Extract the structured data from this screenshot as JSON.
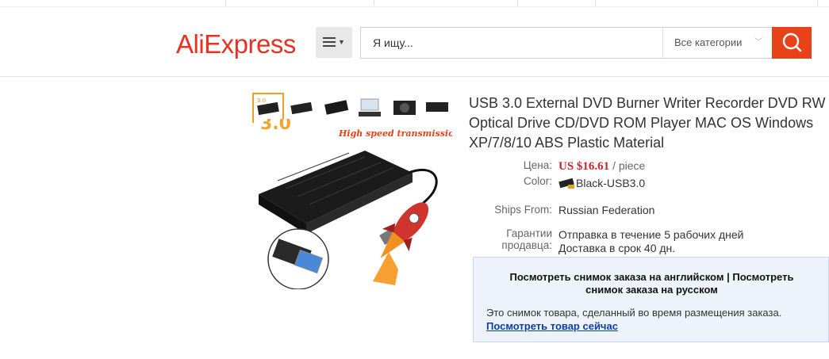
{
  "header": {
    "logo": "AliExpress",
    "search": {
      "placeholder": "Я ищу...",
      "category": "Все категории"
    }
  },
  "product": {
    "title": "USB 3.0 External DVD Burner Writer Recorder DVD RW Optical Drive CD/DVD ROM Player MAC OS Windows XP/7/8/10 ABS Plastic Material",
    "image_banner": "High speed transmission",
    "image_label": "3.0",
    "price_label": "Цена:",
    "price": "US $16.61",
    "price_unit": "/ piece",
    "color_label": "Color:",
    "color_value": "Black-USB3.0",
    "ships_label": "Ships From:",
    "ships_value": "Russian Federation",
    "guarantee_label_1": "Гарантии",
    "guarantee_label_2": "продавца:",
    "guarantee_line_1": "Отправка в течение 5 рабочих дней",
    "guarantee_line_2": "Доставка в срок 40 дн."
  },
  "snapshot": {
    "english_link": "Посмотреть снимок заказа на английском",
    "separator": "|",
    "russian_link_1": "Посмотреть",
    "russian_link_2": "снимок заказа на русском",
    "note": "Это снимок товара, сделанный во время размещения заказа.",
    "view_link": "Посмотреть товар сейчас"
  },
  "colors": {
    "brand": "#e43225",
    "search_button": "#e8421b",
    "price": "#c0282a",
    "link": "#0b3ea5"
  },
  "icons": {
    "menu": "menu-icon",
    "search": "search-icon",
    "chevron": "chevron-down-icon"
  }
}
